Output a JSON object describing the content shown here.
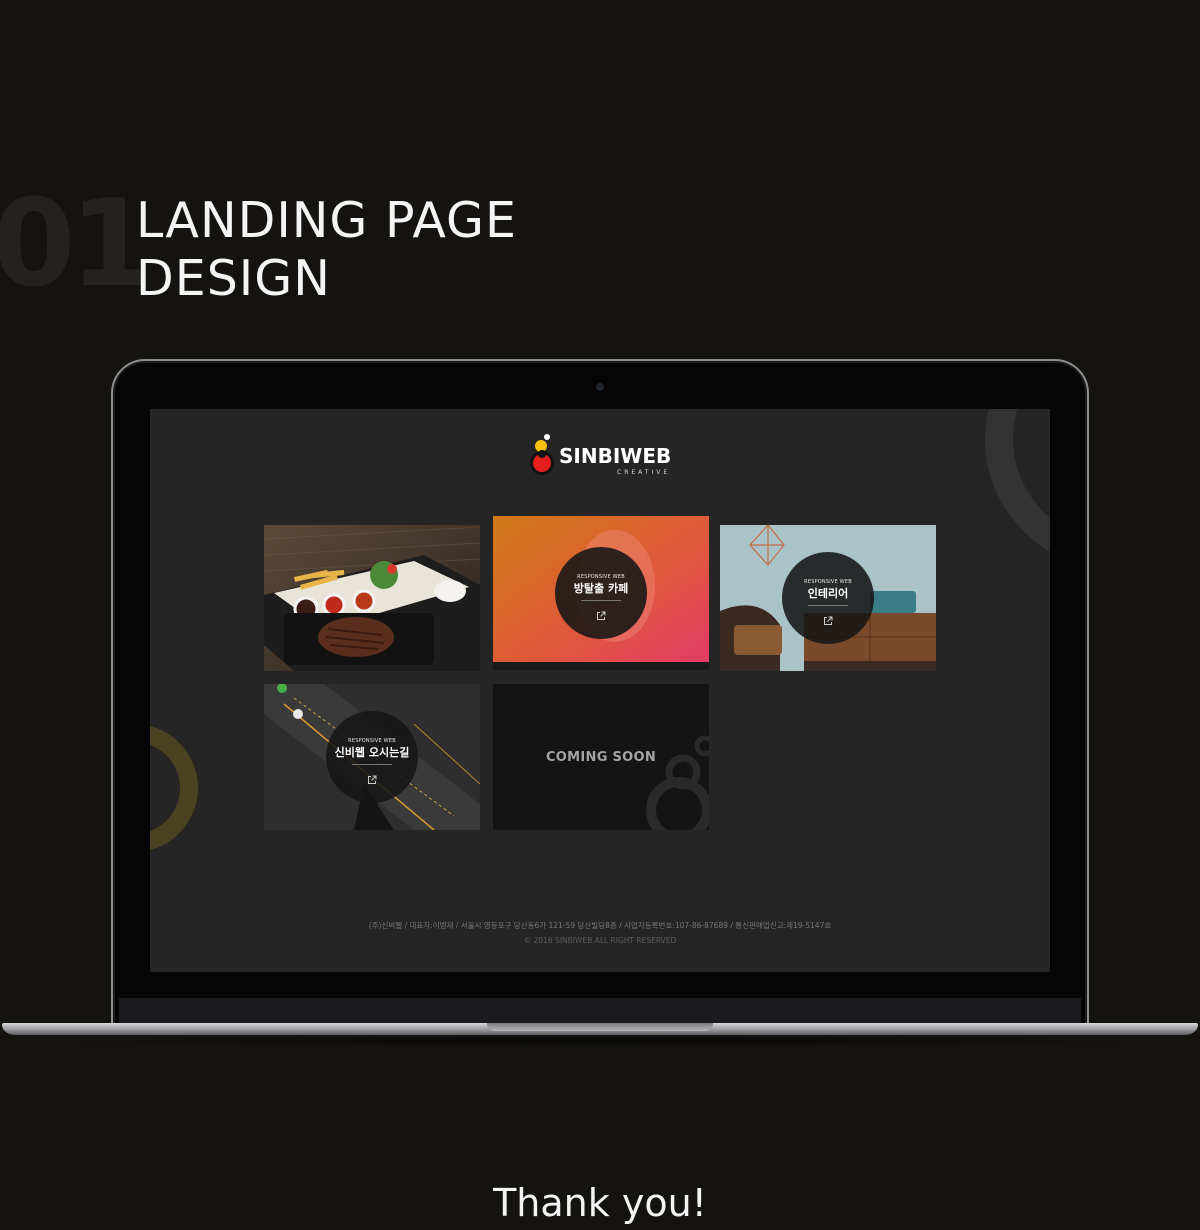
{
  "heading": {
    "number": "01",
    "title_line1": "LANDING PAGE",
    "title_line2": "DESIGN"
  },
  "screen": {
    "logo": {
      "wordmark": "SINBIWEB",
      "subtitle": "CREATIVE",
      "colors": {
        "red": "#e3201e",
        "yellow": "#f5c20b",
        "ring": "#111111"
      }
    },
    "cards": [
      {
        "kind": "image",
        "subject": "steak plate photo"
      },
      {
        "kind": "project",
        "tag": "RESPONSIVE WEB",
        "title": "방탈출 카페",
        "icon": "external-link-icon"
      },
      {
        "kind": "project",
        "tag": "RESPONSIVE WEB",
        "title": "인테리어",
        "icon": "external-link-icon"
      },
      {
        "kind": "project",
        "tag": "RESPONSIVE WEB",
        "title": "신비웹 오시는길",
        "icon": "external-link-icon"
      },
      {
        "kind": "placeholder",
        "title": "COMING SOON"
      }
    ],
    "footer": {
      "info": "(주)신비웹 / 대표자:이범재 / 서울시 영등포구 당산동6가 121-59 당산빌딩8층 / 사업자등록번호:107-86-87689 / 통신판매업신고:제19-5147호",
      "copyright": "© 2016 SINBIWEB ALL RIGHT RESERVED"
    }
  },
  "closing": {
    "text": "Thank you!"
  },
  "colors": {
    "page_bg": "#15130f",
    "screen_bg": "#252525",
    "accent_orange": "#e0841f",
    "accent_pink": "#e53c6a"
  }
}
